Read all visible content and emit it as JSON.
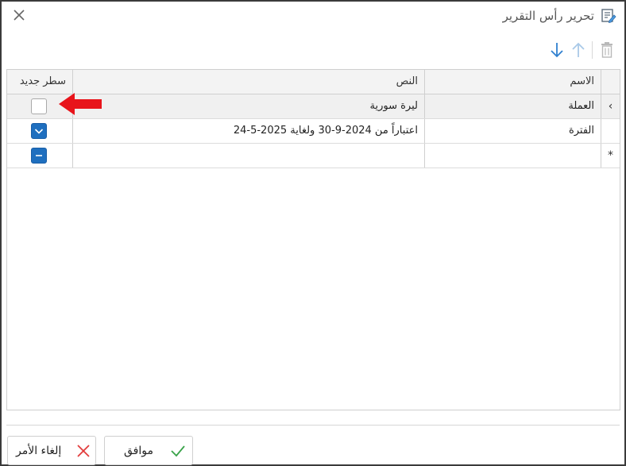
{
  "dialog": {
    "title": "تحرير رأس التقرير",
    "title_icon": "edit-report-icon",
    "close_icon": "close-icon"
  },
  "toolbar": {
    "delete_icon": "trash-icon",
    "move_up_icon": "arrow-up-icon",
    "move_down_icon": "arrow-down-icon"
  },
  "grid": {
    "headers": {
      "name": "الاسم",
      "text": "النص",
      "new_line": "سطر جديد"
    },
    "rows": [
      {
        "indicator": "›",
        "name": "العملة",
        "text": "ليرة سورية",
        "new_line": "unchecked"
      },
      {
        "indicator": "",
        "name": "الفترة",
        "text": "اعتباراً من 2024-9-30 ولغاية 2025-5-24",
        "new_line": "checked"
      },
      {
        "indicator": "*",
        "name": "",
        "text": "",
        "new_line": "indeterminate"
      }
    ]
  },
  "annotation": {
    "icon": "red-arrow-icon",
    "color": "#e8141b"
  },
  "footer": {
    "ok_label": "موافق",
    "cancel_label": "إلغاء الأمر",
    "ok_icon": "check-icon",
    "cancel_icon": "x-icon"
  },
  "colors": {
    "accent": "#1f6fbf",
    "header_bg": "#f3f3f3",
    "selected_row_bg": "#f0f0f0",
    "ok_icon": "#3aa34a",
    "cancel_icon": "#e23b3b"
  }
}
